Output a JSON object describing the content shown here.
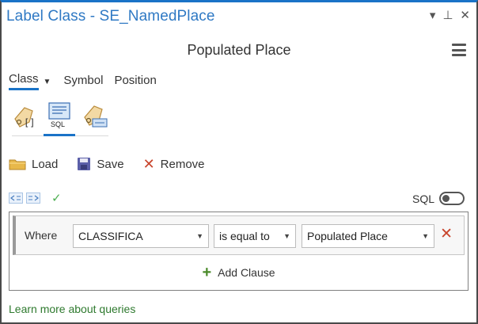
{
  "window": {
    "title": "Label Class - SE_NamedPlace",
    "controls": [
      "▾",
      "⊥",
      "✕"
    ]
  },
  "heading": "Populated Place",
  "tabs": [
    {
      "label": "Class",
      "active": true
    },
    {
      "label": "Symbol",
      "active": false
    },
    {
      "label": "Position",
      "active": false
    }
  ],
  "mode_icons": {
    "sql_label": "SQL"
  },
  "actions": {
    "load": "Load",
    "save": "Save",
    "remove": "Remove"
  },
  "sql_toggle": {
    "label": "SQL",
    "on": false
  },
  "clause": {
    "where": "Where",
    "field": "CLASSIFICA",
    "operator": "is equal to",
    "value": "Populated Place"
  },
  "add_clause": "Add Clause",
  "learn_more": "Learn more about queries",
  "colors": {
    "accent": "#1a73c7",
    "title": "#2f79c4",
    "remove_red": "#c8442b",
    "add_green": "#4a8a2a",
    "link_green": "#2f7a2f"
  }
}
